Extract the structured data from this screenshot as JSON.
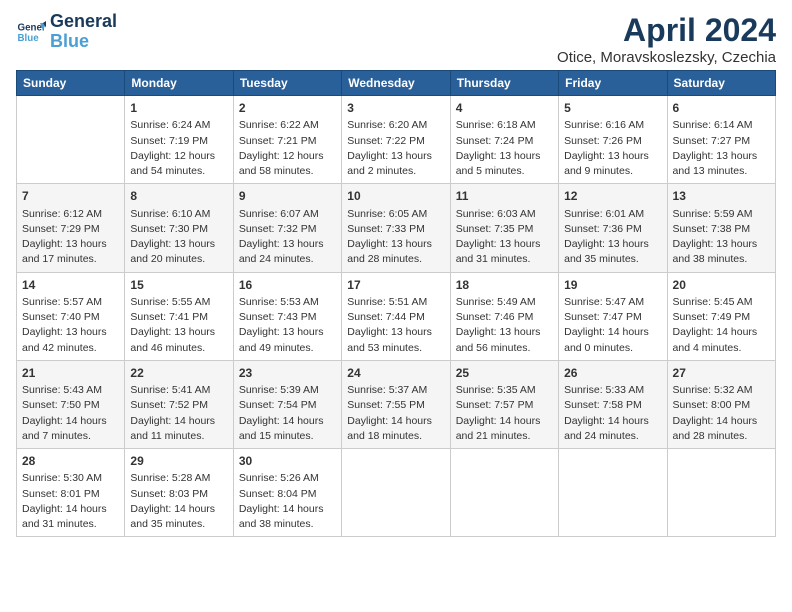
{
  "header": {
    "logo_line1": "General",
    "logo_line2": "Blue",
    "title": "April 2024",
    "subtitle": "Otice, Moravskoslezsky, Czechia"
  },
  "days_of_week": [
    "Sunday",
    "Monday",
    "Tuesday",
    "Wednesday",
    "Thursday",
    "Friday",
    "Saturday"
  ],
  "weeks": [
    [
      {
        "day": "",
        "content": ""
      },
      {
        "day": "1",
        "content": "Sunrise: 6:24 AM\nSunset: 7:19 PM\nDaylight: 12 hours\nand 54 minutes."
      },
      {
        "day": "2",
        "content": "Sunrise: 6:22 AM\nSunset: 7:21 PM\nDaylight: 12 hours\nand 58 minutes."
      },
      {
        "day": "3",
        "content": "Sunrise: 6:20 AM\nSunset: 7:22 PM\nDaylight: 13 hours\nand 2 minutes."
      },
      {
        "day": "4",
        "content": "Sunrise: 6:18 AM\nSunset: 7:24 PM\nDaylight: 13 hours\nand 5 minutes."
      },
      {
        "day": "5",
        "content": "Sunrise: 6:16 AM\nSunset: 7:26 PM\nDaylight: 13 hours\nand 9 minutes."
      },
      {
        "day": "6",
        "content": "Sunrise: 6:14 AM\nSunset: 7:27 PM\nDaylight: 13 hours\nand 13 minutes."
      }
    ],
    [
      {
        "day": "7",
        "content": "Sunrise: 6:12 AM\nSunset: 7:29 PM\nDaylight: 13 hours\nand 17 minutes."
      },
      {
        "day": "8",
        "content": "Sunrise: 6:10 AM\nSunset: 7:30 PM\nDaylight: 13 hours\nand 20 minutes."
      },
      {
        "day": "9",
        "content": "Sunrise: 6:07 AM\nSunset: 7:32 PM\nDaylight: 13 hours\nand 24 minutes."
      },
      {
        "day": "10",
        "content": "Sunrise: 6:05 AM\nSunset: 7:33 PM\nDaylight: 13 hours\nand 28 minutes."
      },
      {
        "day": "11",
        "content": "Sunrise: 6:03 AM\nSunset: 7:35 PM\nDaylight: 13 hours\nand 31 minutes."
      },
      {
        "day": "12",
        "content": "Sunrise: 6:01 AM\nSunset: 7:36 PM\nDaylight: 13 hours\nand 35 minutes."
      },
      {
        "day": "13",
        "content": "Sunrise: 5:59 AM\nSunset: 7:38 PM\nDaylight: 13 hours\nand 38 minutes."
      }
    ],
    [
      {
        "day": "14",
        "content": "Sunrise: 5:57 AM\nSunset: 7:40 PM\nDaylight: 13 hours\nand 42 minutes."
      },
      {
        "day": "15",
        "content": "Sunrise: 5:55 AM\nSunset: 7:41 PM\nDaylight: 13 hours\nand 46 minutes."
      },
      {
        "day": "16",
        "content": "Sunrise: 5:53 AM\nSunset: 7:43 PM\nDaylight: 13 hours\nand 49 minutes."
      },
      {
        "day": "17",
        "content": "Sunrise: 5:51 AM\nSunset: 7:44 PM\nDaylight: 13 hours\nand 53 minutes."
      },
      {
        "day": "18",
        "content": "Sunrise: 5:49 AM\nSunset: 7:46 PM\nDaylight: 13 hours\nand 56 minutes."
      },
      {
        "day": "19",
        "content": "Sunrise: 5:47 AM\nSunset: 7:47 PM\nDaylight: 14 hours\nand 0 minutes."
      },
      {
        "day": "20",
        "content": "Sunrise: 5:45 AM\nSunset: 7:49 PM\nDaylight: 14 hours\nand 4 minutes."
      }
    ],
    [
      {
        "day": "21",
        "content": "Sunrise: 5:43 AM\nSunset: 7:50 PM\nDaylight: 14 hours\nand 7 minutes."
      },
      {
        "day": "22",
        "content": "Sunrise: 5:41 AM\nSunset: 7:52 PM\nDaylight: 14 hours\nand 11 minutes."
      },
      {
        "day": "23",
        "content": "Sunrise: 5:39 AM\nSunset: 7:54 PM\nDaylight: 14 hours\nand 15 minutes."
      },
      {
        "day": "24",
        "content": "Sunrise: 5:37 AM\nSunset: 7:55 PM\nDaylight: 14 hours\nand 18 minutes."
      },
      {
        "day": "25",
        "content": "Sunrise: 5:35 AM\nSunset: 7:57 PM\nDaylight: 14 hours\nand 21 minutes."
      },
      {
        "day": "26",
        "content": "Sunrise: 5:33 AM\nSunset: 7:58 PM\nDaylight: 14 hours\nand 24 minutes."
      },
      {
        "day": "27",
        "content": "Sunrise: 5:32 AM\nSunset: 8:00 PM\nDaylight: 14 hours\nand 28 minutes."
      }
    ],
    [
      {
        "day": "28",
        "content": "Sunrise: 5:30 AM\nSunset: 8:01 PM\nDaylight: 14 hours\nand 31 minutes."
      },
      {
        "day": "29",
        "content": "Sunrise: 5:28 AM\nSunset: 8:03 PM\nDaylight: 14 hours\nand 35 minutes."
      },
      {
        "day": "30",
        "content": "Sunrise: 5:26 AM\nSunset: 8:04 PM\nDaylight: 14 hours\nand 38 minutes."
      },
      {
        "day": "",
        "content": ""
      },
      {
        "day": "",
        "content": ""
      },
      {
        "day": "",
        "content": ""
      },
      {
        "day": "",
        "content": ""
      }
    ]
  ]
}
